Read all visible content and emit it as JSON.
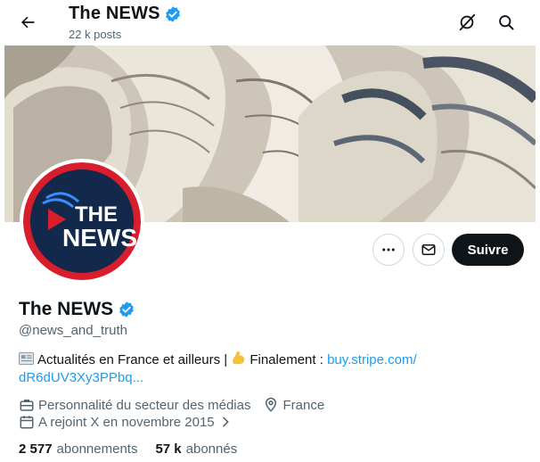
{
  "header": {
    "title": "The NEWS",
    "posts_count": "22 k posts"
  },
  "profile": {
    "display_name": "The NEWS",
    "handle": "@news_and_truth",
    "logo_text_line1": "THE",
    "logo_text_line2": "NEWS",
    "bio_text_1": "Actualités en France et ailleurs | ",
    "bio_text_2": "Finalement : ",
    "bio_link_1": "buy.stripe.com/",
    "bio_link_2": "dR6dUV3Xy3PPbq...",
    "category": "Personnalité du secteur des médias",
    "location": "France",
    "joined": "A rejoint X en novembre 2015"
  },
  "actions": {
    "follow_label": "Suivre"
  },
  "stats": {
    "following_count": "2 577",
    "following_label": "abonnements",
    "followers_count": "57 k",
    "followers_label": "abonnés"
  },
  "colors": {
    "accent": "#1d9bf0",
    "text": "#0f1419",
    "muted": "#536471",
    "logo_red": "#d81e2c",
    "logo_navy": "#13294b"
  },
  "icons": [
    "back-arrow-icon",
    "verified-badge-icon",
    "grok-icon",
    "search-icon",
    "more-icon",
    "message-icon",
    "newspaper-emoji",
    "flexed-biceps-emoji",
    "briefcase-icon",
    "location-pin-icon",
    "calendar-icon",
    "chevron-right-icon"
  ]
}
